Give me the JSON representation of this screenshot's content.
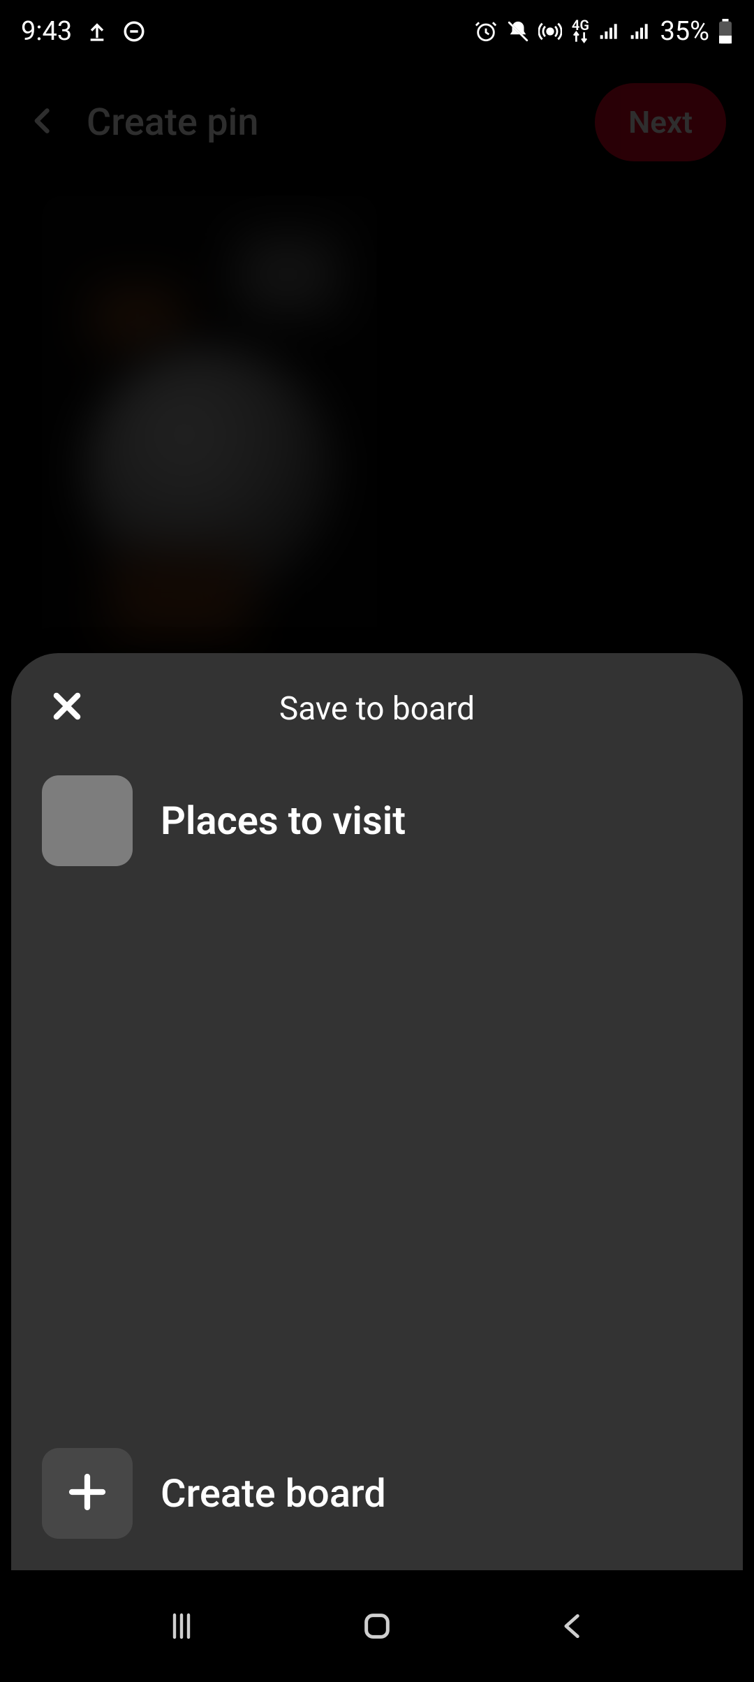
{
  "status": {
    "time": "9:43",
    "battery_text": "35%"
  },
  "bg": {
    "title": "Create pin",
    "next_label": "Next"
  },
  "sheet": {
    "title": "Save to board",
    "boards": [
      {
        "name": "Places to visit"
      }
    ],
    "create_label": "Create board"
  }
}
